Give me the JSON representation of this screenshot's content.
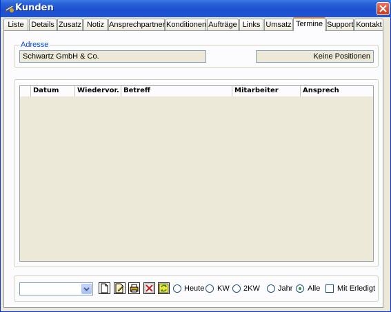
{
  "window": {
    "title": "Kunden"
  },
  "tabs": [
    "Liste",
    "Details",
    "Zusatz",
    "Notiz",
    "Ansprechpartner",
    "Konditionen",
    "Aufträge",
    "Links",
    "Umsatz",
    "Termine",
    "Support",
    "Kontakt"
  ],
  "active_tab": "Termine",
  "address": {
    "legend": "Adresse",
    "name": "Schwartz GmbH  & Co.",
    "positions": "Keine Positionen"
  },
  "table": {
    "columns": [
      "Datum",
      "Wiedervor.",
      "Betreff",
      "Mitarbeiter",
      "Ansprech"
    ]
  },
  "filters": {
    "options": [
      "Heute",
      "KW",
      "2KW",
      "Jahr",
      "Alle"
    ],
    "selected": "Alle",
    "mit_erledigt": "Mit Erledigt"
  }
}
